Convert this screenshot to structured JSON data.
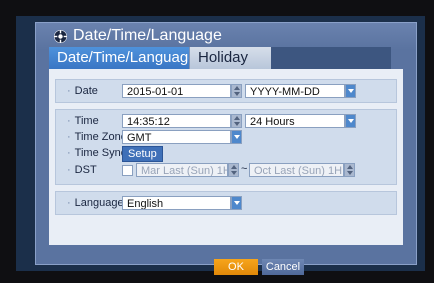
{
  "window": {
    "title": "Date/Time/Language",
    "icon": "gear-icon"
  },
  "tabs": [
    {
      "label": "Date/Time/Language",
      "active": true
    },
    {
      "label": "Holiday",
      "active": false
    }
  ],
  "date": {
    "label": "Date",
    "value": "2015-01-01",
    "format": "YYYY-MM-DD"
  },
  "time": {
    "label": "Time",
    "value": "14:35:12",
    "format": "24 Hours",
    "zone_label": "Time Zone",
    "zone_value": "GMT",
    "sync_label": "Time Sync.",
    "sync_button": "Setup",
    "dst_label": "DST",
    "dst_checked": false,
    "dst_start": "Mar Last (Sun) 1H",
    "dst_separator": "~",
    "dst_end": "Oct Last (Sun) 1H"
  },
  "language": {
    "label": "Language",
    "value": "English"
  },
  "buttons": {
    "ok": "OK",
    "cancel": "Cancel"
  },
  "colors": {
    "active_tab": "#3a76c4",
    "ok_button": "#f09611",
    "dropdown": "#4e88cc"
  }
}
